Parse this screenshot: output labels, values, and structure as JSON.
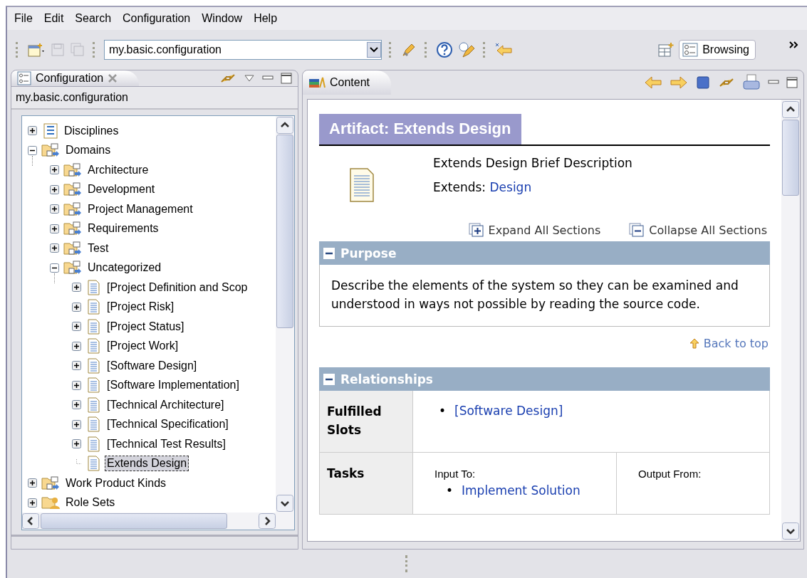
{
  "menu": [
    "File",
    "Edit",
    "Search",
    "Configuration",
    "Window",
    "Help"
  ],
  "toolbar": {
    "configuration_combo": {
      "value": "my.basic.configuration"
    },
    "perspective": {
      "label": "Browsing",
      "selected": true
    }
  },
  "config_view": {
    "tab": {
      "label": "Configuration",
      "selected": true
    },
    "path": "my.basic.configuration",
    "tree": [
      {
        "label": "Disciplines",
        "kind": "discipline",
        "expanded": false,
        "leaf": false,
        "selected": false
      },
      {
        "label": "Domains",
        "kind": "domain",
        "expanded": true,
        "leaf": false,
        "selected": false,
        "children": [
          {
            "label": "Architecture",
            "kind": "domain",
            "expanded": false,
            "leaf": false,
            "selected": false
          },
          {
            "label": "Development",
            "kind": "domain",
            "expanded": false,
            "leaf": false,
            "selected": false
          },
          {
            "label": "Project Management",
            "kind": "domain",
            "expanded": false,
            "leaf": false,
            "selected": false
          },
          {
            "label": "Requirements",
            "kind": "domain",
            "expanded": false,
            "leaf": false,
            "selected": false
          },
          {
            "label": "Test",
            "kind": "domain",
            "expanded": false,
            "leaf": false,
            "selected": false
          },
          {
            "label": "Uncategorized",
            "kind": "domain",
            "expanded": true,
            "leaf": false,
            "selected": false,
            "children": [
              {
                "label": "[Project Definition and Scop",
                "kind": "artifact",
                "expanded": false,
                "leaf": false,
                "selected": false
              },
              {
                "label": "[Project Risk]",
                "kind": "artifact",
                "expanded": false,
                "leaf": false,
                "selected": false
              },
              {
                "label": "[Project Status]",
                "kind": "artifact",
                "expanded": false,
                "leaf": false,
                "selected": false
              },
              {
                "label": "[Project Work]",
                "kind": "artifact",
                "expanded": false,
                "leaf": false,
                "selected": false
              },
              {
                "label": "[Software Design]",
                "kind": "artifact",
                "expanded": false,
                "leaf": false,
                "selected": false
              },
              {
                "label": "[Software Implementation]",
                "kind": "artifact",
                "expanded": false,
                "leaf": false,
                "selected": false
              },
              {
                "label": "[Technical Architecture]",
                "kind": "artifact",
                "expanded": false,
                "leaf": false,
                "selected": false
              },
              {
                "label": "[Technical Specification]",
                "kind": "artifact",
                "expanded": false,
                "leaf": false,
                "selected": false
              },
              {
                "label": "[Technical Test Results]",
                "kind": "artifact",
                "expanded": false,
                "leaf": false,
                "selected": false
              },
              {
                "label": "Extends Design",
                "kind": "artifact",
                "leaf": true,
                "selected": true
              }
            ]
          }
        ]
      },
      {
        "label": "Work Product Kinds",
        "kind": "domain",
        "expanded": false,
        "leaf": false,
        "selected": false
      },
      {
        "label": "Role Sets",
        "kind": "roleset",
        "expanded": false,
        "leaf": false,
        "selected": false
      }
    ]
  },
  "content_view": {
    "tab": {
      "label": "Content",
      "selected": true
    },
    "title": "Artifact: Extends Design",
    "brief": "Extends Design Brief Description",
    "extends_label": "Extends:",
    "extends_link": "Design",
    "expand_all": "Expand All Sections",
    "collapse_all": "Collapse All Sections",
    "back_to_top": "Back to top",
    "sections": [
      {
        "title": "Purpose",
        "kind": "text",
        "expanded": true,
        "text": " Describe the elements of the system so they can be examined and understood in ways not possible by reading the source code."
      },
      {
        "title": "Relationships",
        "kind": "table",
        "expanded": true,
        "rows": [
          {
            "label": "Fulfilled Slots",
            "kind": "list",
            "bullet": "•",
            "links": [
              "[Software Design]"
            ]
          },
          {
            "label": "Tasks",
            "kind": "split",
            "input_label": "Input To:",
            "bullet": "•",
            "input_links": [
              "Implement Solution"
            ],
            "output_label": "Output From:"
          }
        ]
      }
    ]
  }
}
